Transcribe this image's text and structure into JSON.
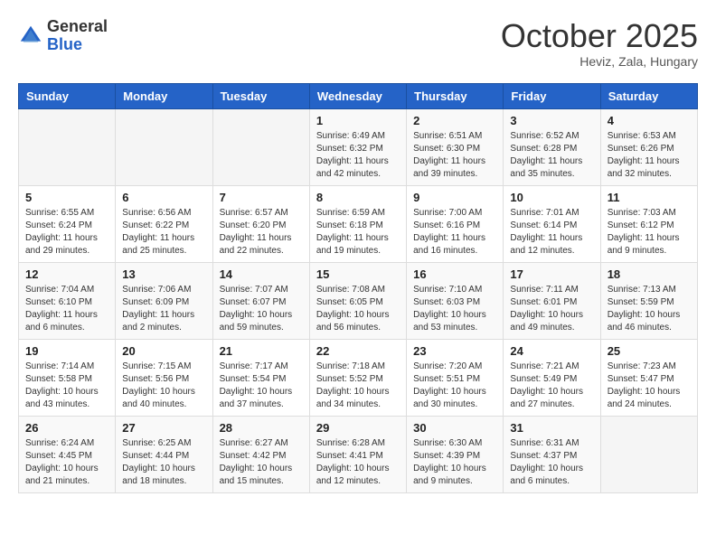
{
  "header": {
    "logo_line1": "General",
    "logo_line2": "Blue",
    "month": "October 2025",
    "location": "Heviz, Zala, Hungary"
  },
  "weekdays": [
    "Sunday",
    "Monday",
    "Tuesday",
    "Wednesday",
    "Thursday",
    "Friday",
    "Saturday"
  ],
  "weeks": [
    [
      {
        "day": "",
        "content": ""
      },
      {
        "day": "",
        "content": ""
      },
      {
        "day": "",
        "content": ""
      },
      {
        "day": "1",
        "content": "Sunrise: 6:49 AM\nSunset: 6:32 PM\nDaylight: 11 hours\nand 42 minutes."
      },
      {
        "day": "2",
        "content": "Sunrise: 6:51 AM\nSunset: 6:30 PM\nDaylight: 11 hours\nand 39 minutes."
      },
      {
        "day": "3",
        "content": "Sunrise: 6:52 AM\nSunset: 6:28 PM\nDaylight: 11 hours\nand 35 minutes."
      },
      {
        "day": "4",
        "content": "Sunrise: 6:53 AM\nSunset: 6:26 PM\nDaylight: 11 hours\nand 32 minutes."
      }
    ],
    [
      {
        "day": "5",
        "content": "Sunrise: 6:55 AM\nSunset: 6:24 PM\nDaylight: 11 hours\nand 29 minutes."
      },
      {
        "day": "6",
        "content": "Sunrise: 6:56 AM\nSunset: 6:22 PM\nDaylight: 11 hours\nand 25 minutes."
      },
      {
        "day": "7",
        "content": "Sunrise: 6:57 AM\nSunset: 6:20 PM\nDaylight: 11 hours\nand 22 minutes."
      },
      {
        "day": "8",
        "content": "Sunrise: 6:59 AM\nSunset: 6:18 PM\nDaylight: 11 hours\nand 19 minutes."
      },
      {
        "day": "9",
        "content": "Sunrise: 7:00 AM\nSunset: 6:16 PM\nDaylight: 11 hours\nand 16 minutes."
      },
      {
        "day": "10",
        "content": "Sunrise: 7:01 AM\nSunset: 6:14 PM\nDaylight: 11 hours\nand 12 minutes."
      },
      {
        "day": "11",
        "content": "Sunrise: 7:03 AM\nSunset: 6:12 PM\nDaylight: 11 hours\nand 9 minutes."
      }
    ],
    [
      {
        "day": "12",
        "content": "Sunrise: 7:04 AM\nSunset: 6:10 PM\nDaylight: 11 hours\nand 6 minutes."
      },
      {
        "day": "13",
        "content": "Sunrise: 7:06 AM\nSunset: 6:09 PM\nDaylight: 11 hours\nand 2 minutes."
      },
      {
        "day": "14",
        "content": "Sunrise: 7:07 AM\nSunset: 6:07 PM\nDaylight: 10 hours\nand 59 minutes."
      },
      {
        "day": "15",
        "content": "Sunrise: 7:08 AM\nSunset: 6:05 PM\nDaylight: 10 hours\nand 56 minutes."
      },
      {
        "day": "16",
        "content": "Sunrise: 7:10 AM\nSunset: 6:03 PM\nDaylight: 10 hours\nand 53 minutes."
      },
      {
        "day": "17",
        "content": "Sunrise: 7:11 AM\nSunset: 6:01 PM\nDaylight: 10 hours\nand 49 minutes."
      },
      {
        "day": "18",
        "content": "Sunrise: 7:13 AM\nSunset: 5:59 PM\nDaylight: 10 hours\nand 46 minutes."
      }
    ],
    [
      {
        "day": "19",
        "content": "Sunrise: 7:14 AM\nSunset: 5:58 PM\nDaylight: 10 hours\nand 43 minutes."
      },
      {
        "day": "20",
        "content": "Sunrise: 7:15 AM\nSunset: 5:56 PM\nDaylight: 10 hours\nand 40 minutes."
      },
      {
        "day": "21",
        "content": "Sunrise: 7:17 AM\nSunset: 5:54 PM\nDaylight: 10 hours\nand 37 minutes."
      },
      {
        "day": "22",
        "content": "Sunrise: 7:18 AM\nSunset: 5:52 PM\nDaylight: 10 hours\nand 34 minutes."
      },
      {
        "day": "23",
        "content": "Sunrise: 7:20 AM\nSunset: 5:51 PM\nDaylight: 10 hours\nand 30 minutes."
      },
      {
        "day": "24",
        "content": "Sunrise: 7:21 AM\nSunset: 5:49 PM\nDaylight: 10 hours\nand 27 minutes."
      },
      {
        "day": "25",
        "content": "Sunrise: 7:23 AM\nSunset: 5:47 PM\nDaylight: 10 hours\nand 24 minutes."
      }
    ],
    [
      {
        "day": "26",
        "content": "Sunrise: 6:24 AM\nSunset: 4:45 PM\nDaylight: 10 hours\nand 21 minutes."
      },
      {
        "day": "27",
        "content": "Sunrise: 6:25 AM\nSunset: 4:44 PM\nDaylight: 10 hours\nand 18 minutes."
      },
      {
        "day": "28",
        "content": "Sunrise: 6:27 AM\nSunset: 4:42 PM\nDaylight: 10 hours\nand 15 minutes."
      },
      {
        "day": "29",
        "content": "Sunrise: 6:28 AM\nSunset: 4:41 PM\nDaylight: 10 hours\nand 12 minutes."
      },
      {
        "day": "30",
        "content": "Sunrise: 6:30 AM\nSunset: 4:39 PM\nDaylight: 10 hours\nand 9 minutes."
      },
      {
        "day": "31",
        "content": "Sunrise: 6:31 AM\nSunset: 4:37 PM\nDaylight: 10 hours\nand 6 minutes."
      },
      {
        "day": "",
        "content": ""
      }
    ]
  ]
}
